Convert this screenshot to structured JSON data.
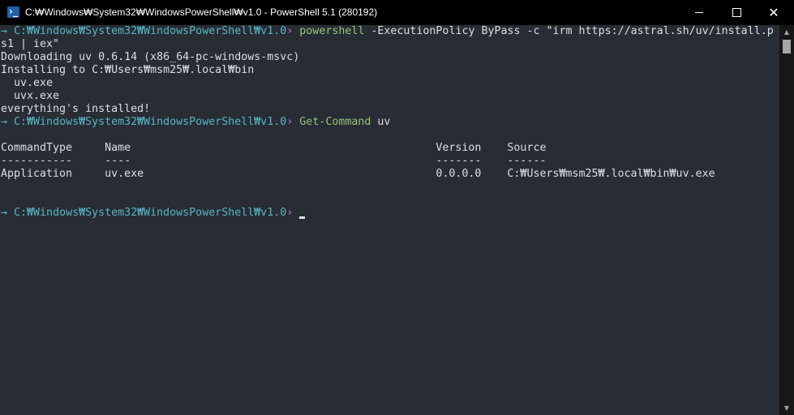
{
  "window": {
    "title": "C:₩Windows₩System32₩WindowsPowerShell₩v1.0 - PowerShell 5.1 (280192)",
    "icon": "powershell-icon"
  },
  "controls": {
    "minimize": "minimize-icon",
    "maximize": "maximize-icon",
    "close": "close-icon"
  },
  "colors": {
    "background": "#282c34",
    "prompt_arrow": "#56b6c2",
    "prompt_path": "#56b6c2",
    "prompt_gt": "#c678dd",
    "command": "#98c379",
    "text": "#dcdfe4"
  },
  "prompt": {
    "arrow": "→",
    "path": "C:₩Windows₩System32₩WindowsPowerShell₩v1.0",
    "symbol": "›"
  },
  "session": {
    "cmd1": {
      "name": "powershell",
      "args_line1": "-ExecutionPolicy ByPass -c \"irm https://astral.sh/uv/install.p",
      "args_line2": "s1 | iex\""
    },
    "output1": [
      "Downloading uv 0.6.14 (x86_64-pc-windows-msvc)",
      "Installing to C:₩Users₩msm25₩.local₩bin",
      "  uv.exe",
      "  uvx.exe",
      "everything's installed!"
    ],
    "cmd2": {
      "name": "Get-Command",
      "args": "uv"
    },
    "table": {
      "header": "CommandType     Name                                               Version    Source",
      "separator": "-----------     ----                                               -------    ------",
      "row": "Application     uv.exe                                             0.0.0.0    C:₩Users₩msm25₩.local₩bin₩uv.exe"
    }
  },
  "scrollbar": {
    "up": "scroll-up-arrow-icon",
    "down": "scroll-down-arrow-icon"
  }
}
